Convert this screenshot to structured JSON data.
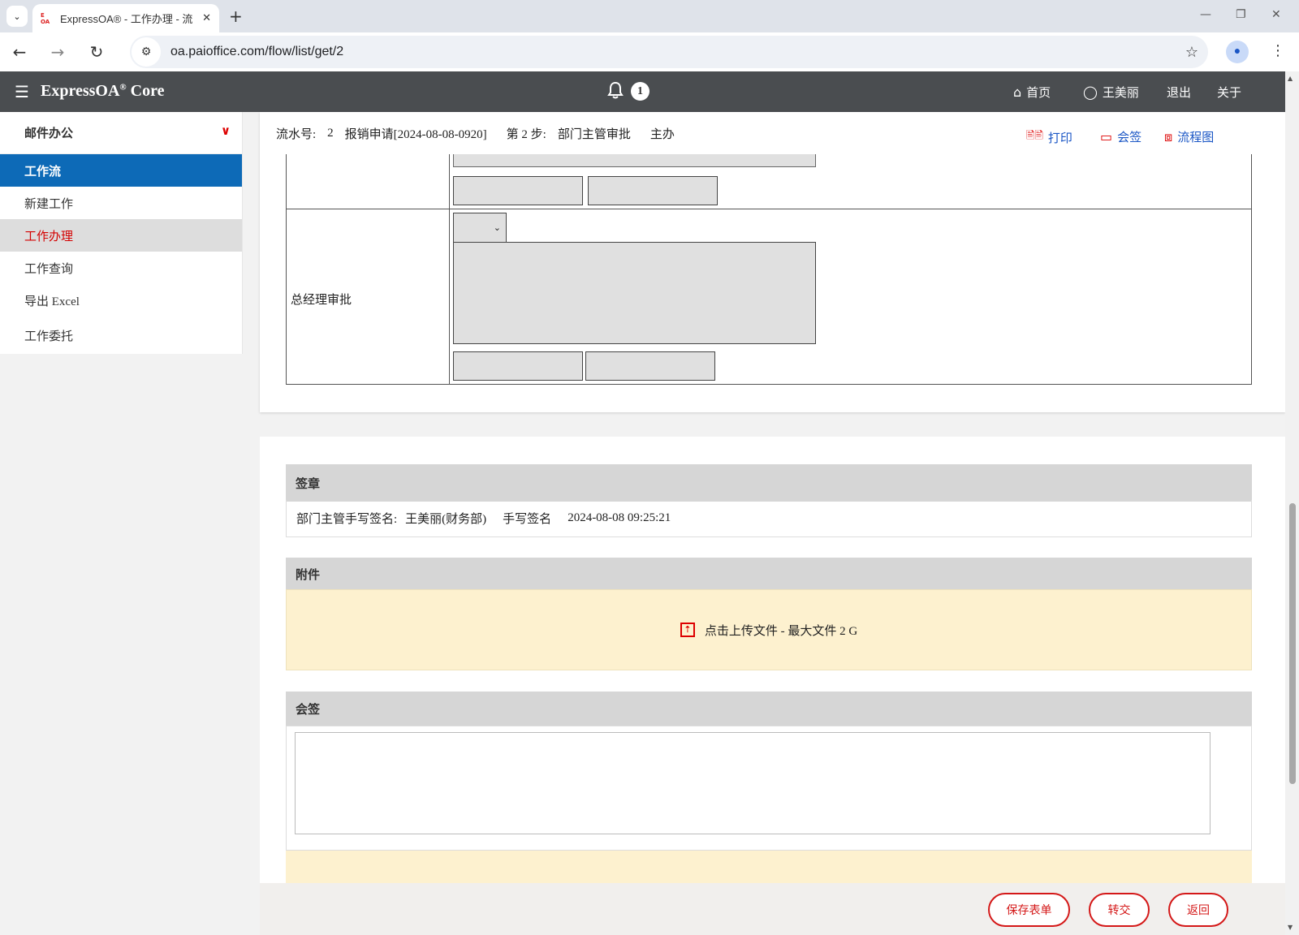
{
  "browser": {
    "tab_title": "ExpressOA® - 工作办理 - 流",
    "tab_favicon": "E\nOA",
    "url": "oa.paioffice.com/flow/list/get/2",
    "icons": {
      "tab_dropdown": "⌄",
      "close": "✕",
      "new_tab": "+",
      "back": "←",
      "forward": "→",
      "reload": "↻",
      "site_info": "⚙",
      "star": "☆",
      "profile": "●",
      "kebab": "⋮",
      "minimize": "—",
      "restore": "❐",
      "window_close": "✕"
    }
  },
  "header": {
    "menu_icon": "☰",
    "brand": "ExpressOA",
    "brand_sup": "®",
    "brand_suffix": " Core",
    "bell_icon": "🔔",
    "notification_count": "1",
    "nav": {
      "home_icon": "⌂",
      "home": "首页",
      "user_icon": "◯",
      "user": "王美丽",
      "logout": "退出",
      "about": "关于"
    }
  },
  "sidebar": {
    "group": "邮件办公",
    "group_chevron": "∨",
    "section": "工作流",
    "items": [
      "新建工作",
      "工作办理",
      "工作查询",
      "导出 Excel",
      "工作委托"
    ]
  },
  "flow_info": {
    "serial_label": "流水号:",
    "serial_value": "2",
    "title": "报销申请[2024-08-08-0920]",
    "step_label": "第 2 步:",
    "step_name": "部门主管审批",
    "role": "主办",
    "print_icons": "🖹🖹",
    "print": "打印",
    "countersign_icon": "▭",
    "countersign": "会签",
    "flowchart_icon": "⧈",
    "flowchart": "流程图"
  },
  "form": {
    "gm_approval_label": "总经理审批",
    "select_arrow": "⌄"
  },
  "signature": {
    "heading": "签章",
    "label": "部门主管手写签名:",
    "signer": "王美丽(财务部)",
    "type": "手写签名",
    "time": "2024-08-08 09:25:21"
  },
  "attachments": {
    "heading": "附件",
    "upload_icon": "⇡",
    "upload_text": "点击上传文件 - 最大文件 2 G"
  },
  "countersign_panel": {
    "heading": "会签"
  },
  "footer": {
    "save": "保存表单",
    "transfer": "转交",
    "back": "返回"
  },
  "scrollbar": {
    "up": "▲",
    "down": "▼"
  }
}
